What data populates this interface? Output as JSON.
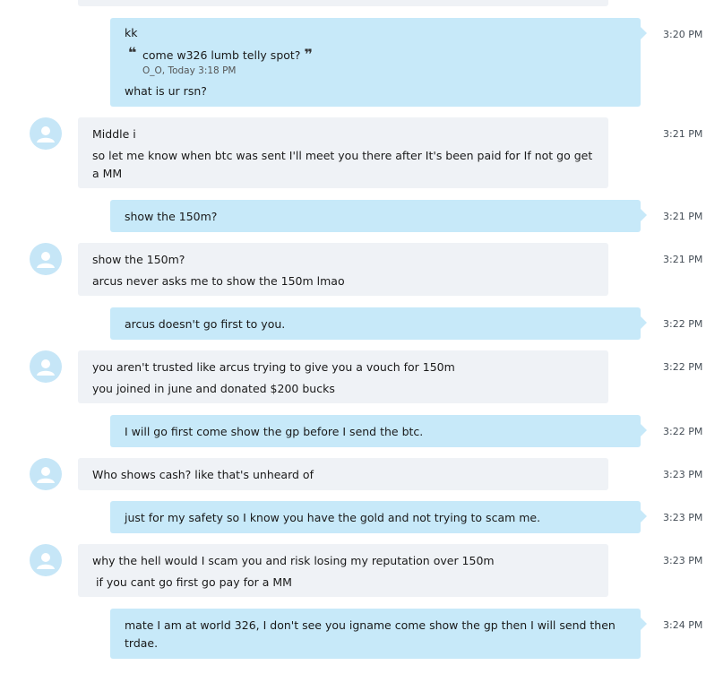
{
  "messages": [
    {
      "dir": "out",
      "time": "3:20 PM",
      "lines": [
        "kk"
      ],
      "quote": {
        "text": "come w326 lumb telly spot?",
        "author_time": "O_O, Today 3:18 PM"
      },
      "after": [
        "what is ur rsn?"
      ]
    },
    {
      "dir": "in",
      "time": "3:21 PM",
      "lines": [
        "Middle i",
        "so let me know when btc was sent I'll meet you there after It's been paid for If not go get a MM"
      ]
    },
    {
      "dir": "out",
      "time": "3:21 PM",
      "lines": [
        "show the 150m?"
      ]
    },
    {
      "dir": "in",
      "time": "3:21 PM",
      "lines": [
        "show the 150m?",
        "arcus never asks me to show the 150m lmao"
      ]
    },
    {
      "dir": "out",
      "time": "3:22 PM",
      "lines": [
        "arcus doesn't go first to you."
      ]
    },
    {
      "dir": "in",
      "time": "3:22 PM",
      "lines": [
        "you aren't trusted like arcus trying to give you a vouch for 150m",
        "you joined in june and donated $200 bucks"
      ]
    },
    {
      "dir": "out",
      "time": "3:22 PM",
      "lines": [
        "I will go first come show the gp before I send the btc."
      ]
    },
    {
      "dir": "in",
      "time": "3:23 PM",
      "lines": [
        "Who shows cash? like that's unheard of"
      ]
    },
    {
      "dir": "out",
      "time": "3:23 PM",
      "lines": [
        "just for my safety so I know you have the gold and not trying to scam me."
      ]
    },
    {
      "dir": "in",
      "time": "3:23 PM",
      "lines": [
        "why the hell would I scam you and risk losing my reputation over 150m",
        " if you cant go first go pay for a MM"
      ]
    },
    {
      "dir": "out",
      "time": "3:24 PM",
      "lines": [
        "mate I am at world 326, I don't see you igname come show the gp then I will send then trdae."
      ]
    }
  ],
  "colors": {
    "outgoing": "#c7e9f9",
    "incoming": "#eff2f6",
    "avatar": "#c6e6f7"
  },
  "icons": {
    "avatar": "default-user-icon",
    "quote_open": "quote-open-icon",
    "quote_close": "quote-close-icon"
  }
}
